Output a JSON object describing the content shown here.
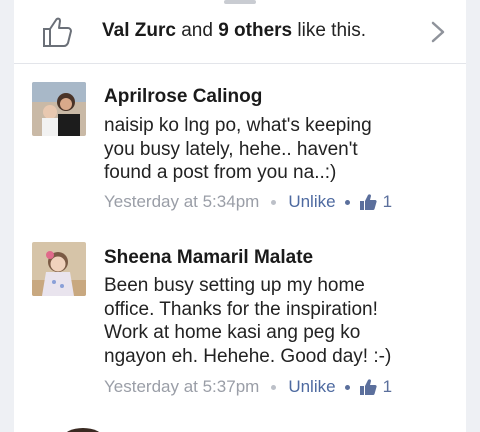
{
  "likes": {
    "name": "Val Zurc",
    "connector": " and ",
    "others": "9 others",
    "suffix": " like this."
  },
  "comments": [
    {
      "author": "Aprilrose Calinog",
      "text": "naisip ko lng po, what's keeping\nyou busy lately, hehe.. haven't\nfound a post from you na..:)",
      "time": "Yesterday at 5:34pm",
      "action": "Unlike",
      "like_count": "1"
    },
    {
      "author": "Sheena Mamaril Malate",
      "text": "Been busy setting up my home\noffice. Thanks for the inspiration!\nWork at home kasi ang peg ko\nngayon eh. Hehehe. Good day! :-)",
      "time": "Yesterday at 5:37pm",
      "action": "Unlike",
      "like_count": "1"
    }
  ],
  "colors": {
    "link": "#4e6aa0",
    "meta_gray": "#9a9ea7",
    "background": "#eef0f4"
  },
  "icons": [
    "thumbs-up-icon",
    "chevron-right-icon",
    "like-icon"
  ]
}
